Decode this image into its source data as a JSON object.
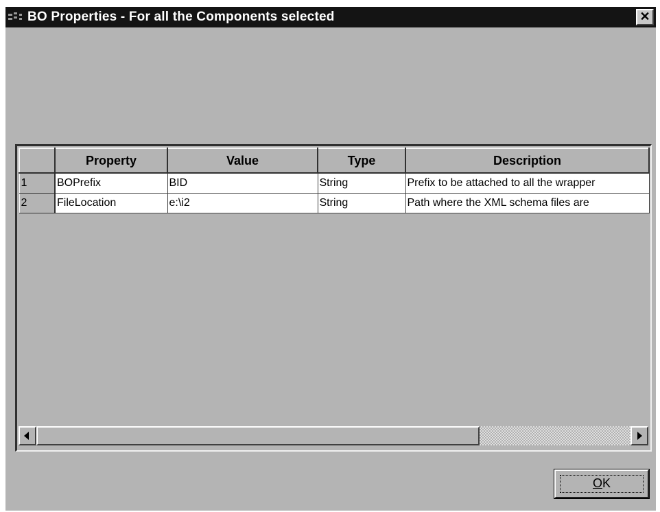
{
  "window": {
    "title": "BO Properties - For all the Components selected",
    "close_label": "✕"
  },
  "grid": {
    "columns": [
      "Property",
      "Value",
      "Type",
      "Description"
    ],
    "rows": [
      {
        "num": "1",
        "cells": [
          "BOPrefix",
          "BID",
          "String",
          "Prefix to be attached to all the wrapper"
        ]
      },
      {
        "num": "2",
        "cells": [
          "FileLocation",
          "e:\\i2",
          "String",
          "Path where the XML schema files are"
        ]
      }
    ]
  },
  "buttons": {
    "ok_mnemonic": "O",
    "ok_rest": "K"
  },
  "colors": {
    "titlebar": "#141414",
    "face": "#b4b4b4",
    "cell": "#ffffff"
  },
  "icons": [
    "system-menu-icon",
    "close-icon",
    "scroll-left-arrow-icon",
    "scroll-right-arrow-icon"
  ]
}
